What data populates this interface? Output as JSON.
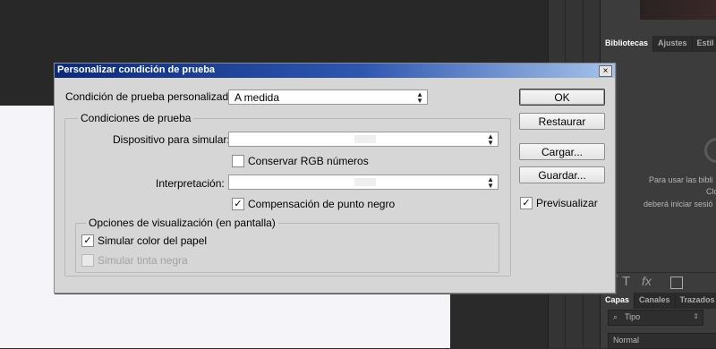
{
  "dialog": {
    "title": "Personalizar condición de prueba",
    "close_glyph": "×",
    "custom_condition_label": "Condición de prueba personalizada:",
    "custom_condition_value": "A medida",
    "proof_group_title": "Condiciones de prueba",
    "device_label": "Dispositivo para simular:",
    "device_value": "",
    "preserve_rgb_label": "Conservar RGB números",
    "preserve_rgb_checked": false,
    "intent_label": "Interpretación:",
    "intent_value": "",
    "bpc_label": "Compensación de punto negro",
    "bpc_checked": true,
    "display_group_title": "Opciones de visualización (en pantalla)",
    "paper_color_label": "Simular color del papel",
    "paper_color_checked": true,
    "black_ink_label": "Simular tinta negra",
    "black_ink_checked": false,
    "buttons": {
      "ok": "OK",
      "reset": "Restaurar",
      "load": "Cargar...",
      "save": "Guardar..."
    },
    "preview_label": "Previsualizar",
    "preview_checked": true
  },
  "right_panel": {
    "top_tabs": [
      "Bibliotecas",
      "Ajustes",
      "Estil"
    ],
    "library_text_lines": [
      "Para usar las bibli",
      "Clo",
      "deberá iniciar sesió"
    ],
    "footer_icons": [
      "🖌",
      "T",
      "fx"
    ],
    "bottom_tabs": [
      "Capas",
      "Canales",
      "Trazados"
    ],
    "layer_filter": "Tipo",
    "blend_mode": "Normal"
  }
}
